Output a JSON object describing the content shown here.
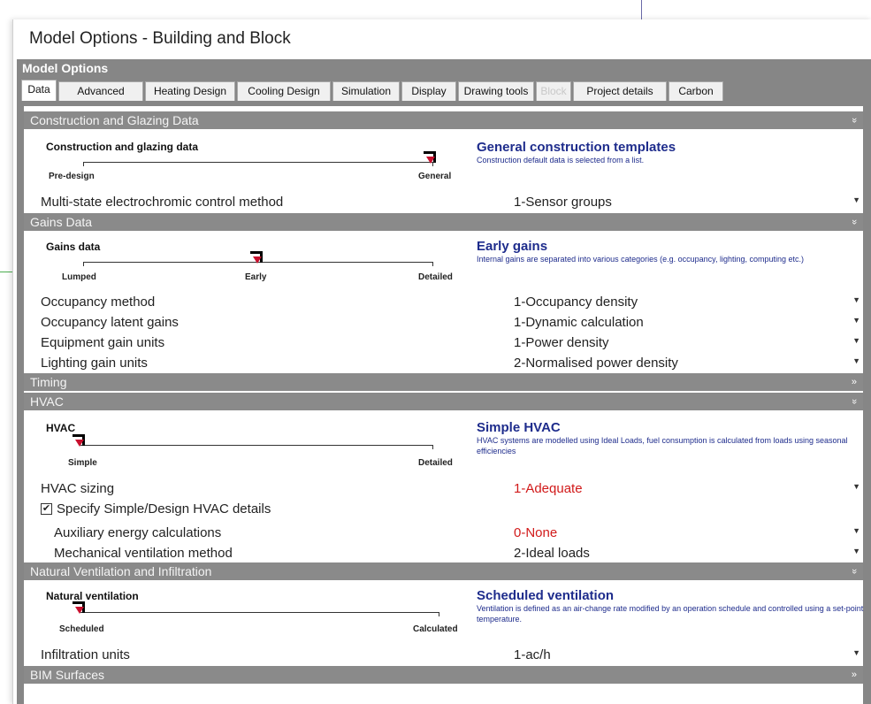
{
  "window": {
    "title": "Model Options - Building and Block"
  },
  "panel_title": "Model Options",
  "tabs": [
    {
      "label": "Data",
      "active": true
    },
    {
      "label": "Advanced"
    },
    {
      "label": "Heating Design"
    },
    {
      "label": "Cooling Design"
    },
    {
      "label": "Simulation"
    },
    {
      "label": "Display"
    },
    {
      "label": "Drawing tools"
    },
    {
      "label": "Block",
      "disabled": true
    },
    {
      "label": "Project details"
    },
    {
      "label": "Carbon"
    }
  ],
  "sections": {
    "construction": {
      "header": "Construction and Glazing Data",
      "header_icon": "double-chevron-down-icon",
      "slider": {
        "label": "Construction and glazing data",
        "ticks": [
          "Pre-design",
          "General"
        ],
        "selected": "General"
      },
      "description": {
        "title": "General construction templates",
        "text": "Construction default data is selected from a list."
      },
      "rows": [
        {
          "label": "Multi-state electrochromic control method",
          "value": "1-Sensor groups"
        }
      ]
    },
    "gains": {
      "header": "Gains Data",
      "header_icon": "double-chevron-down-icon",
      "slider": {
        "label": "Gains data",
        "ticks": [
          "Lumped",
          "Early",
          "Detailed"
        ],
        "selected": "Early"
      },
      "description": {
        "title": "Early gains",
        "text": "Internal gains are separated into various categories (e.g. occupancy, lighting, computing etc.)"
      },
      "rows": [
        {
          "label": "Occupancy method",
          "value": "1-Occupancy density"
        },
        {
          "label": "Occupancy latent gains",
          "value": "1-Dynamic calculation"
        },
        {
          "label": "Equipment gain units",
          "value": "1-Power density"
        },
        {
          "label": "Lighting gain units",
          "value": "2-Normalised power density"
        }
      ]
    },
    "timing": {
      "header": "Timing",
      "header_icon": "double-chevron-right-icon"
    },
    "hvac": {
      "header": "HVAC",
      "header_icon": "double-chevron-down-icon",
      "slider": {
        "label": "HVAC",
        "ticks": [
          "Simple",
          "Detailed"
        ],
        "selected": "Simple"
      },
      "description": {
        "title": "Simple HVAC",
        "text": "HVAC systems are modelled using Ideal Loads, fuel consumption is calculated from loads using seasonal efficiencies"
      },
      "rows": [
        {
          "label": "HVAC sizing",
          "value": "1-Adequate",
          "value_color": "#d11a1a"
        }
      ],
      "checkbox": {
        "label": "Specify Simple/Design HVAC details",
        "checked": true,
        "mark": "✔"
      },
      "subrows": [
        {
          "label": "Auxiliary energy calculations",
          "value": "0-None",
          "value_color": "#d11a1a"
        },
        {
          "label": "Mechanical ventilation method",
          "value": "2-Ideal loads"
        }
      ]
    },
    "natvent": {
      "header": "Natural Ventilation and Infiltration",
      "header_icon": "double-chevron-down-icon",
      "slider": {
        "label": "Natural ventilation",
        "ticks": [
          "Scheduled",
          "Calculated"
        ],
        "selected": "Scheduled"
      },
      "description": {
        "title": "Scheduled ventilation",
        "text": "Ventilation is defined as an air-change rate modified by an operation schedule and controlled using a set-point temperature."
      },
      "rows": [
        {
          "label": "Infiltration units",
          "value": "1-ac/h"
        }
      ]
    },
    "bim": {
      "header": "BIM Surfaces",
      "header_icon": "double-chevron-right-icon"
    }
  },
  "icons": {
    "dropdown": "dropdown-arrow-icon",
    "chev_down": "»",
    "chev_right": "»"
  }
}
